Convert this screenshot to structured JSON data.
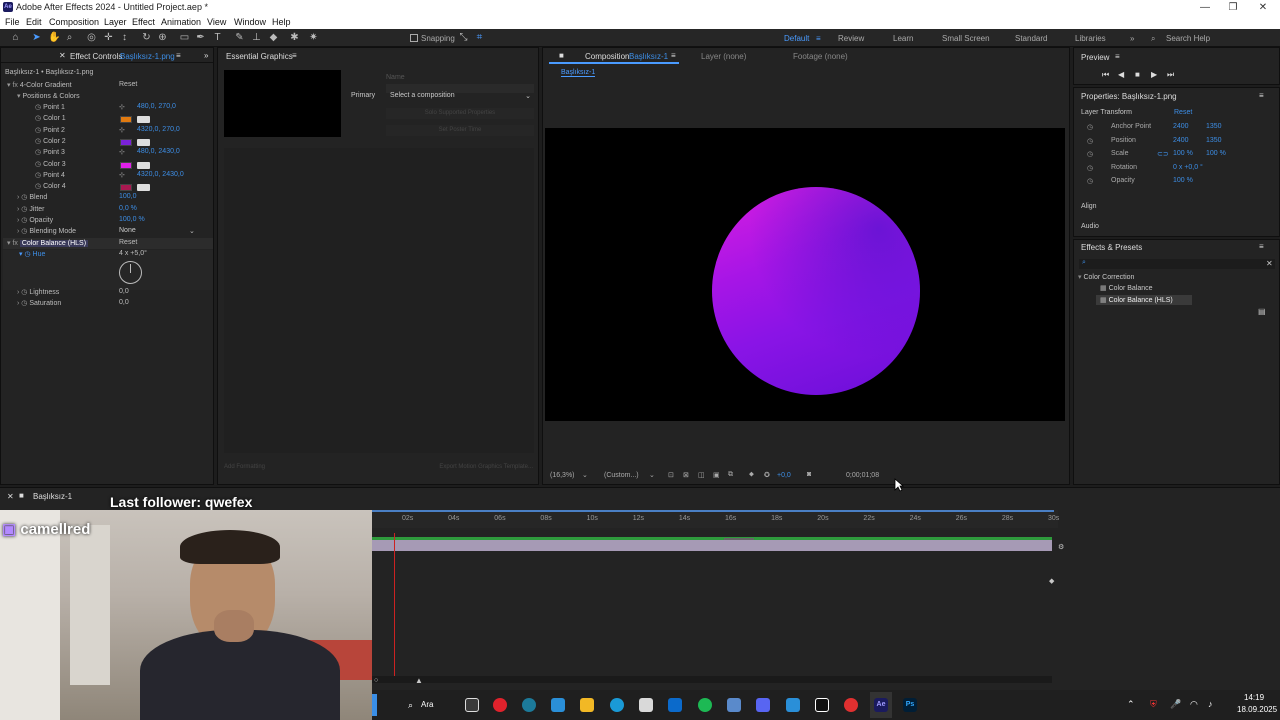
{
  "app": {
    "title": "Adobe After Effects 2024 - Untitled Project.aep *"
  },
  "window": {
    "minimize": "—",
    "maximize": "❐",
    "close": "✕"
  },
  "menu": [
    "File",
    "Edit",
    "Composition",
    "Layer",
    "Effect",
    "Animation",
    "View",
    "Window",
    "Help"
  ],
  "toolbar": {
    "snapping": "Snapping",
    "workspaces": [
      "Default",
      "Review",
      "Learn",
      "Small Screen",
      "Standard",
      "Libraries"
    ],
    "search_help": "Search Help"
  },
  "effect_controls": {
    "tab_label": "Effect Controls",
    "tab_layer": "Başlıksız-1.png",
    "header": "Başlıksız-1 • Başlıksız-1.png",
    "effect1_name": "4-Color Gradient",
    "effect1_reset": "Reset",
    "group": "Positions & Colors",
    "props": [
      {
        "label": "Point 1",
        "value": "480,0, 270,0"
      },
      {
        "label": "Color 1",
        "color": "#e07a10"
      },
      {
        "label": "Point 2",
        "value": "4320,0, 270,0"
      },
      {
        "label": "Color 2",
        "color": "#7a22d8"
      },
      {
        "label": "Point 3",
        "value": "480,0, 2430,0"
      },
      {
        "label": "Color 3",
        "color": "#e020e8"
      },
      {
        "label": "Point 4",
        "value": "4320,0, 2430,0"
      },
      {
        "label": "Color 4",
        "color": "#a81850"
      },
      {
        "label": "Blend",
        "value": "100,0"
      },
      {
        "label": "Jitter",
        "value": "0,0 %"
      },
      {
        "label": "Opacity",
        "value": "100,0 %"
      },
      {
        "label": "Blending Mode",
        "value": "None"
      }
    ],
    "effect2_name": "Color Balance (HLS)",
    "effect2_reset": "Reset",
    "hue_label": "Hue",
    "hue_value": "4 x +5,0°",
    "lightness_label": "Lightness",
    "lightness_value": "0,0",
    "saturation_label": "Saturation",
    "saturation_value": "0,0"
  },
  "essential_graphics": {
    "tab": "Essential Graphics",
    "name_label": "Name",
    "primary_label": "Primary",
    "primary_value": "Select a composition",
    "solo_btn": "Solo Supported Properties",
    "poster_btn": "Set Poster Time",
    "add_formatting": "Add Formatting",
    "export_btn": "Export Motion Graphics Template..."
  },
  "composition": {
    "tab_prefix": "Composition",
    "tab_name": "Başlıksız-1",
    "layer_tab": "Layer (none)",
    "footage_tab": "Footage (none)",
    "breadcrumb": "Başlıksız-1",
    "zoom": "(16,3%)",
    "resolution": "(Custom...)",
    "exposure": "+0,0",
    "timecode": "0;00;01;08"
  },
  "preview": {
    "tab": "Preview"
  },
  "properties": {
    "title": "Properties: Başlıksız-1.png",
    "section": "Layer Transform",
    "reset": "Reset",
    "rows": [
      {
        "label": "Anchor Point",
        "v1": "2400",
        "v2": "1350"
      },
      {
        "label": "Position",
        "v1": "2400",
        "v2": "1350"
      },
      {
        "label": "Scale",
        "v1": "100 %",
        "v2": "100 %"
      },
      {
        "label": "Rotation",
        "v1": "0 x +0,0 °",
        "v2": ""
      },
      {
        "label": "Opacity",
        "v1": "100 %",
        "v2": ""
      }
    ],
    "align": "Align",
    "audio": "Audio"
  },
  "effects_presets": {
    "title": "Effects & Presets",
    "search_value": "",
    "category": "Color Correction",
    "items": [
      "Color Balance",
      "Color Balance (HLS)"
    ]
  },
  "timeline": {
    "comp_tab": "Başlıksız-1",
    "ticks": [
      "02s",
      "04s",
      "06s",
      "08s",
      "10s",
      "12s",
      "14s",
      "16s",
      "18s",
      "20s",
      "22s",
      "24s",
      "26s",
      "28s",
      "30s"
    ]
  },
  "overlay": {
    "follower": "Last follower: qwefex",
    "streamer": "camellred"
  },
  "taskbar": {
    "search": "Ara",
    "time": "14:19",
    "date": "18.09.2025"
  }
}
